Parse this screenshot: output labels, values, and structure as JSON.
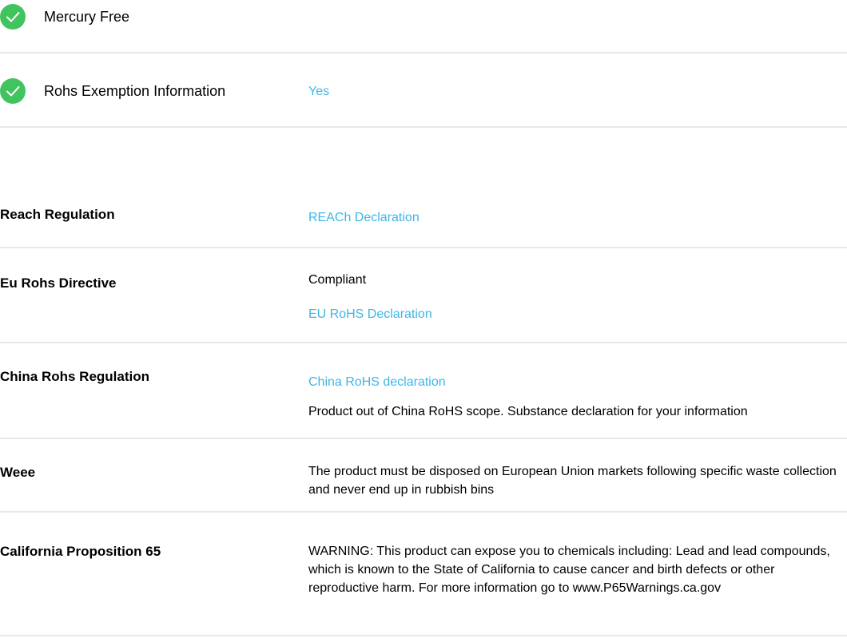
{
  "flags": [
    {
      "label": "Mercury Free",
      "value": ""
    },
    {
      "label": "Rohs Exemption Information",
      "value": "Yes"
    }
  ],
  "regulations": {
    "reach": {
      "label": "Reach Regulation",
      "link": "REACh Declaration"
    },
    "eu_rohs": {
      "label": "Eu Rohs Directive",
      "status": "Compliant",
      "link": "EU RoHS Declaration"
    },
    "china_rohs": {
      "label": "China Rohs Regulation",
      "link": "China RoHS declaration",
      "note": "Product out of China RoHS scope. Substance declaration for your information"
    },
    "weee": {
      "label": "Weee",
      "text": "The product must be disposed on European Union markets following specific waste collection and never end up in rubbish bins"
    },
    "prop65": {
      "label": "California Proposition 65",
      "text": "WARNING: This product can expose you to chemicals including: Lead and lead compounds, which is known to the State of California to cause cancer and birth defects or other reproductive harm. For more information go to www.P65Warnings.ca.gov"
    }
  },
  "colors": {
    "check_green": "#41c35e",
    "link_blue": "#3db5e6",
    "divider": "#e8e8e8"
  },
  "icons": {
    "check": "check-circle-icon"
  }
}
